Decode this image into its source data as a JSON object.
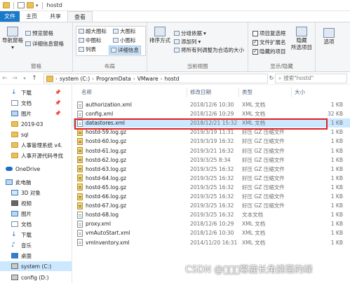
{
  "window": {
    "title": "hostd"
  },
  "ribbon_tabs": [
    {
      "label": "文件"
    },
    {
      "label": "主页"
    },
    {
      "label": "共享"
    },
    {
      "label": "查看"
    }
  ],
  "ribbon": {
    "panes": {
      "nav_pane": "导航窗格",
      "preview": "预览窗格",
      "details": "详细信息窗格",
      "group_label": "窗格"
    },
    "layout": {
      "items": [
        "超大图标",
        "大图标",
        "中图标",
        "小图标",
        "列表",
        "详细信息"
      ],
      "group_label": "布局"
    },
    "current_view": {
      "sort": "排序方式",
      "group_by": "分组依据",
      "add_columns": "添加列",
      "fit_columns": "将所有列调整为合适的大小",
      "group_label": "当前视图"
    },
    "show_hide": {
      "item_checkbox": "项目复选框",
      "file_ext": "文件扩展名",
      "hidden_items": "隐藏的项目",
      "hide": "隐藏",
      "selected_items": "所选项目",
      "group_label": "显示/隐藏"
    },
    "options": "选项"
  },
  "address": {
    "crumbs": [
      "system (C:)",
      "ProgramData",
      "VMware",
      "hostd"
    ],
    "search_placeholder": "搜索\"hostd\""
  },
  "nav": [
    {
      "label": "下载",
      "pinned": true
    },
    {
      "label": "文档",
      "pinned": true
    },
    {
      "label": "图片",
      "pinned": true
    },
    {
      "label": "2019-03"
    },
    {
      "label": "sql"
    },
    {
      "label": "人事管理系统 v4."
    },
    {
      "label": "人事开源代码寻找"
    },
    {
      "label": "OneDrive"
    },
    {
      "label": "此电脑"
    },
    {
      "label": "3D 对象"
    },
    {
      "label": "视频"
    },
    {
      "label": "图片"
    },
    {
      "label": "文档"
    },
    {
      "label": "下载"
    },
    {
      "label": "音乐"
    },
    {
      "label": "桌面"
    },
    {
      "label": "system (C:)"
    },
    {
      "label": "config (D:)"
    }
  ],
  "columns": {
    "name": "名称",
    "date": "修改日期",
    "type": "类型",
    "size": "大小"
  },
  "files": [
    {
      "name": "authorization.xml",
      "date": "2018/12/6 10:30",
      "type": "XML 文档",
      "size": "1 KB"
    },
    {
      "name": "config.xml",
      "date": "2018/12/6 10:29",
      "type": "XML 文档",
      "size": "32 KB"
    },
    {
      "name": "datastores.xml",
      "date": "2018/12/21 15:32",
      "type": "XML 文档",
      "size": "1 KB"
    },
    {
      "name": "hostd-59.log.gz",
      "date": "2019/3/19 11:31",
      "type": "好压 GZ 压缩文件",
      "size": "1 KB"
    },
    {
      "name": "hostd-60.log.gz",
      "date": "2019/3/19 16:32",
      "type": "好压 GZ 压缩文件",
      "size": "1 KB"
    },
    {
      "name": "hostd-61.log.gz",
      "date": "2019/3/21 16:32",
      "type": "好压 GZ 压缩文件",
      "size": "1 KB"
    },
    {
      "name": "hostd-62.log.gz",
      "date": "2019/3/25 8:34",
      "type": "好压 GZ 压缩文件",
      "size": "1 KB"
    },
    {
      "name": "hostd-63.log.gz",
      "date": "2019/3/25 16:32",
      "type": "好压 GZ 压缩文件",
      "size": "1 KB"
    },
    {
      "name": "hostd-64.log.gz",
      "date": "2019/3/25 16:32",
      "type": "好压 GZ 压缩文件",
      "size": "1 KB"
    },
    {
      "name": "hostd-65.log.gz",
      "date": "2019/3/25 16:32",
      "type": "好压 GZ 压缩文件",
      "size": "1 KB"
    },
    {
      "name": "hostd-66.log.gz",
      "date": "2019/3/25 16:32",
      "type": "好压 GZ 压缩文件",
      "size": "1 KB"
    },
    {
      "name": "hostd-67.log.gz",
      "date": "2019/3/25 16:32",
      "type": "好压 GZ 压缩文件",
      "size": "1 KB"
    },
    {
      "name": "hostd-68.log",
      "date": "2019/3/25 16:32",
      "type": "文本文档",
      "size": "1 KB"
    },
    {
      "name": "proxy.xml",
      "date": "2018/12/6 10:29",
      "type": "XML 文档",
      "size": "1 KB"
    },
    {
      "name": "vmAutoStart.xml",
      "date": "2018/12/6 10:30",
      "type": "XML 文档",
      "size": "1 KB"
    },
    {
      "name": "vmInventory.xml",
      "date": "2014/11/20 16:31",
      "type": "XML 文档",
      "size": "1 KB"
    }
  ],
  "watermark": "CSDN @\u0000\u0000\u0000幂鹿长角拂落的绿"
}
